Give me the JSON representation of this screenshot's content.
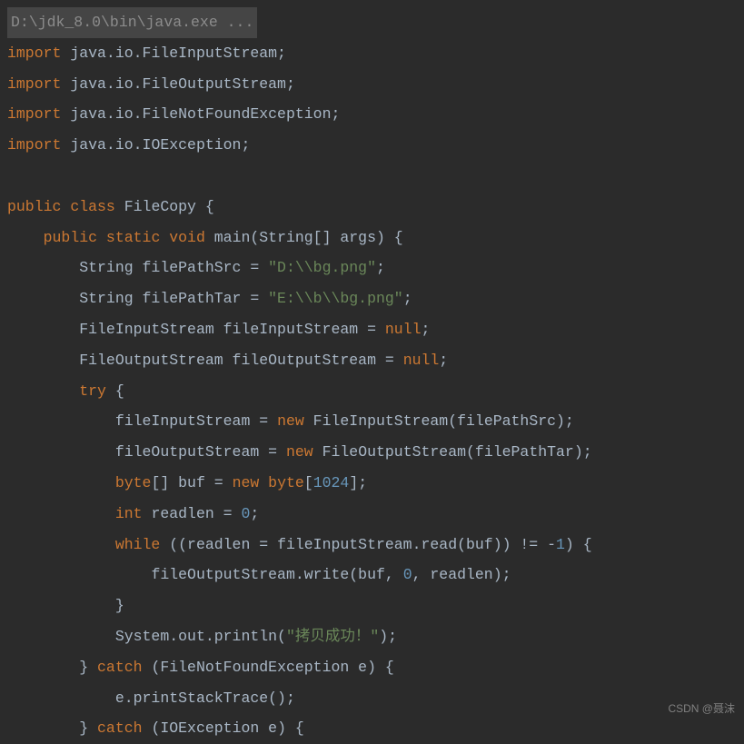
{
  "exec_header": "D:\\jdk_8.0\\bin\\java.exe ...",
  "lines": {
    "l1_import": "import",
    "l1_pkg": " java.io.FileInputStream;",
    "l2_import": "import",
    "l2_pkg": " java.io.FileOutputStream;",
    "l3_import": "import",
    "l3_pkg": " java.io.FileNotFoundException;",
    "l4_import": "import",
    "l4_pkg": " java.io.IOException;",
    "l5_public": "public",
    "l5_class": " class",
    "l5_name": " FileCopy {",
    "l6_indent": "    ",
    "l6_public": "public",
    "l6_static": " static",
    "l6_void": " void",
    "l6_rest": " main(String[] args) {",
    "l7_indent": "        ",
    "l7_decl": "String filePathSrc = ",
    "l7_str": "\"D:\\\\bg.png\"",
    "l7_semi": ";",
    "l8_indent": "        ",
    "l8_decl": "String filePathTar = ",
    "l8_str": "\"E:\\\\b\\\\bg.png\"",
    "l8_semi": ";",
    "l9_indent": "        ",
    "l9_text": "FileInputStream fileInputStream = ",
    "l9_null": "null",
    "l9_semi": ";",
    "l10_indent": "        ",
    "l10_text": "FileOutputStream fileOutputStream = ",
    "l10_null": "null",
    "l10_semi": ";",
    "l11_indent": "        ",
    "l11_try": "try",
    "l11_brace": " {",
    "l12_indent": "            ",
    "l12_text1": "fileInputStream = ",
    "l12_new": "new",
    "l12_text2": " FileInputStream(filePathSrc);",
    "l13_indent": "            ",
    "l13_text1": "fileOutputStream = ",
    "l13_new": "new",
    "l13_text2": " FileOutputStream(filePathTar);",
    "l14_indent": "            ",
    "l14_byte": "byte",
    "l14_text1": "[] buf = ",
    "l14_new": "new",
    "l14_text2": " byte",
    "l14_text3": "[",
    "l14_num": "1024",
    "l14_text4": "];",
    "l15_indent": "            ",
    "l15_int": "int",
    "l15_text": " readlen = ",
    "l15_num": "0",
    "l15_semi": ";",
    "l16_indent": "            ",
    "l16_while": "while",
    "l16_text1": " ((readlen = fileInputStream.read(buf)) != -",
    "l16_num": "1",
    "l16_text2": ") {",
    "l17_indent": "                ",
    "l17_text1": "fileOutputStream.write(buf, ",
    "l17_num": "0",
    "l17_text2": ", readlen);",
    "l18_indent": "            ",
    "l18_brace": "}",
    "l19_indent": "            ",
    "l19_text1": "System.out.println(",
    "l19_str1": "\"",
    "l19_str_cn": "拷贝成功！",
    "l19_str2": "\"",
    "l19_text2": ");",
    "l20_indent": "        ",
    "l20_text1": "} ",
    "l20_catch": "catch",
    "l20_text2": " (FileNotFoundException e) {",
    "l21_indent": "            ",
    "l21_text": "e.printStackTrace();",
    "l22_indent": "        ",
    "l22_text1": "} ",
    "l22_catch": "catch",
    "l22_text2": " (IOException e) {"
  },
  "watermark": "CSDN @聂沫"
}
